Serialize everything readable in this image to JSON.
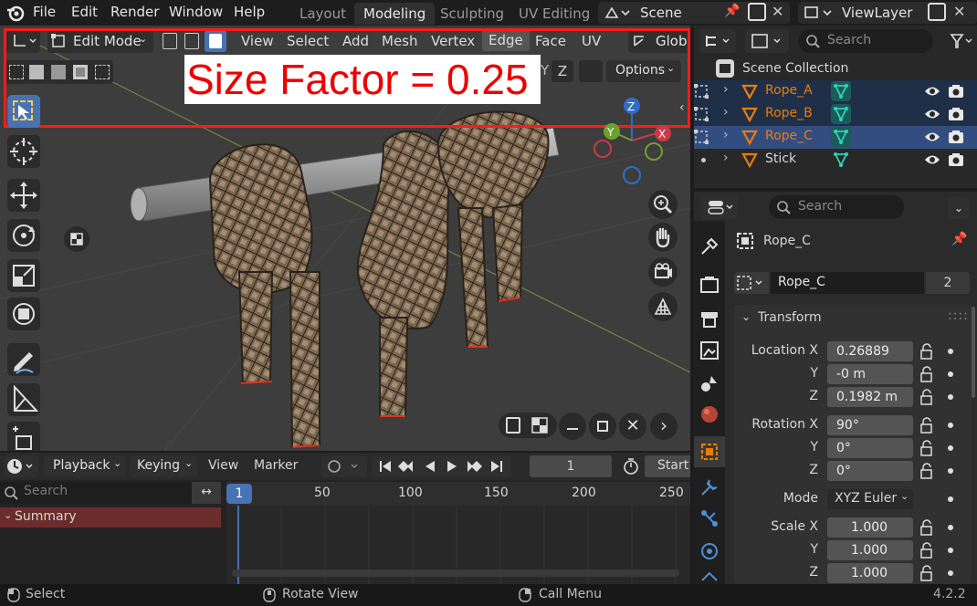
{
  "menu": [
    "File",
    "Edit",
    "Render",
    "Window",
    "Help"
  ],
  "workspaces": [
    "Layout",
    "Modeling",
    "Sculpting",
    "UV Editing"
  ],
  "active_workspace": "Modeling",
  "scene_name": "Scene",
  "view_layer": "ViewLayer",
  "viewport": {
    "mode": "Edit Mode",
    "menus": [
      "View",
      "Select",
      "Add",
      "Mesh",
      "Vertex",
      "Edge",
      "Face",
      "UV"
    ],
    "highlighted_menu": "Edge",
    "transform_orientation": "Global",
    "options_label": "Options",
    "overlay_caption": "Size Factor = 0.25",
    "axes": {
      "z": "Z",
      "x": "X",
      "y": "Y"
    },
    "axis_letters_row": [
      "Y",
      "Z"
    ]
  },
  "outliner": {
    "search_placeholder": "Search",
    "collection": "Scene Collection",
    "items": [
      {
        "name": "Rope_A",
        "selected": true,
        "active": false
      },
      {
        "name": "Rope_B",
        "selected": true,
        "active": false
      },
      {
        "name": "Rope_C",
        "selected": true,
        "active": true
      },
      {
        "name": "Stick",
        "selected": false,
        "active": false
      }
    ]
  },
  "properties": {
    "search_placeholder": "Search",
    "object_name": "Rope_C",
    "data_name": "Rope_C",
    "users": "2",
    "panel_title": "Transform",
    "location": {
      "label": "Location X",
      "x": "0.26889",
      "y": "-0 m",
      "z": "0.1982 m"
    },
    "rotation": {
      "label": "Rotation X",
      "x": "90°",
      "y": "0°",
      "z": "0°"
    },
    "mode_label": "Mode",
    "mode_value": "XYZ Euler",
    "scale": {
      "label": "Scale X",
      "x": "1.000",
      "y": "1.000",
      "z": "1.000"
    },
    "axis_labels": {
      "y": "Y",
      "z": "Z"
    }
  },
  "timeline": {
    "menus": [
      "Playback",
      "Keying",
      "View",
      "Marker"
    ],
    "current_frame": "1",
    "start_label": "Start",
    "search_placeholder": "Search",
    "summary_label": "Summary",
    "ruler": [
      "1",
      "50",
      "100",
      "150",
      "200",
      "250"
    ]
  },
  "status": {
    "select": "Select",
    "rotate": "Rotate View",
    "call_menu": "Call Menu",
    "version": "4.2.2"
  },
  "colors": {
    "accent": "#4772b3",
    "selection_orange": "#e87d0d",
    "highlight_box": "#ff1a1a",
    "red_axis": "#c93a46",
    "green_axis": "#6ba32a",
    "blue_axis": "#2f6dc8"
  }
}
